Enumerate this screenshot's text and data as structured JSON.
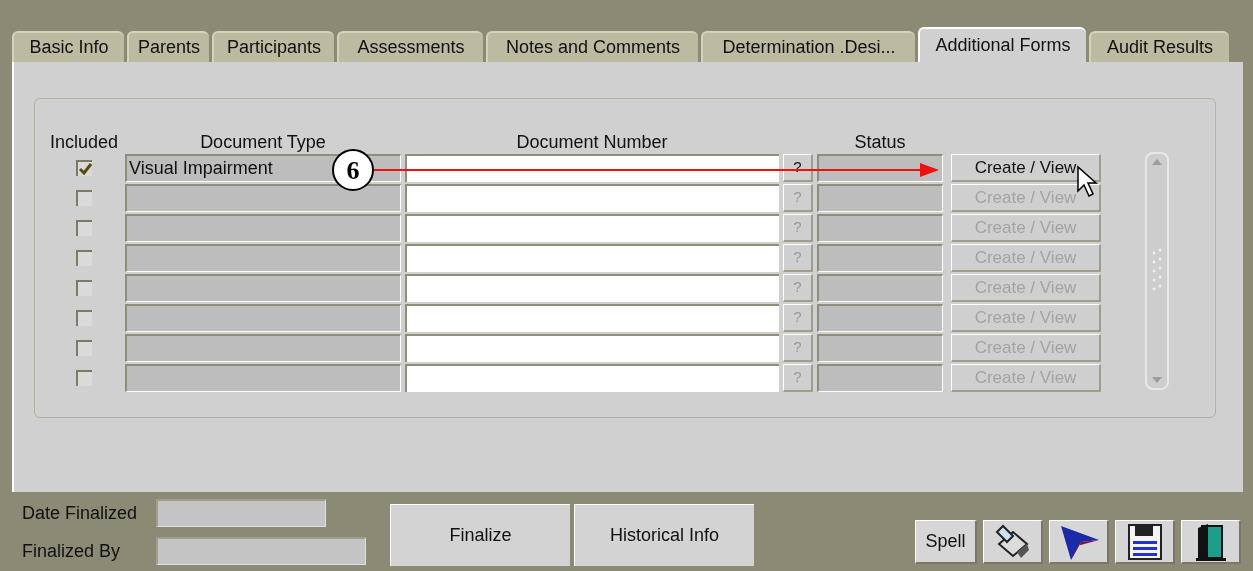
{
  "tabs": [
    {
      "label": "Basic Info",
      "selected": false
    },
    {
      "label": "Parents",
      "selected": false
    },
    {
      "label": "Participants",
      "selected": false
    },
    {
      "label": "Assessments",
      "selected": false
    },
    {
      "label": "Notes and Comments",
      "selected": false
    },
    {
      "label": "Determination .Desi...",
      "selected": false
    },
    {
      "label": "Additional Forms",
      "selected": true
    },
    {
      "label": "Audit Results",
      "selected": false
    }
  ],
  "table": {
    "columns": [
      "Included",
      "Document Type",
      "Document Number",
      "Status"
    ],
    "rows": [
      {
        "included": true,
        "document_type": "Visual Impairment",
        "help": "?",
        "action": "Create / View",
        "disabled": false
      },
      {
        "included": false,
        "help": "?",
        "action": "Create / View",
        "disabled": true
      },
      {
        "included": false,
        "help": "?",
        "action": "Create / View",
        "disabled": true
      },
      {
        "included": false,
        "help": "?",
        "action": "Create / View",
        "disabled": true
      },
      {
        "included": false,
        "help": "?",
        "action": "Create / View",
        "disabled": true
      },
      {
        "included": false,
        "help": "?",
        "action": "Create / View",
        "disabled": true
      },
      {
        "included": false,
        "help": "?",
        "action": "Create / View",
        "disabled": true
      },
      {
        "included": false,
        "help": "?",
        "action": "Create / View",
        "disabled": true
      }
    ]
  },
  "callout": {
    "number": "6"
  },
  "footer": {
    "fields": [
      {
        "label": "Date Finalized"
      },
      {
        "label": "Finalized By"
      }
    ],
    "buttons": [
      "Finalize",
      "Historical Info"
    ],
    "spell": "Spell"
  }
}
